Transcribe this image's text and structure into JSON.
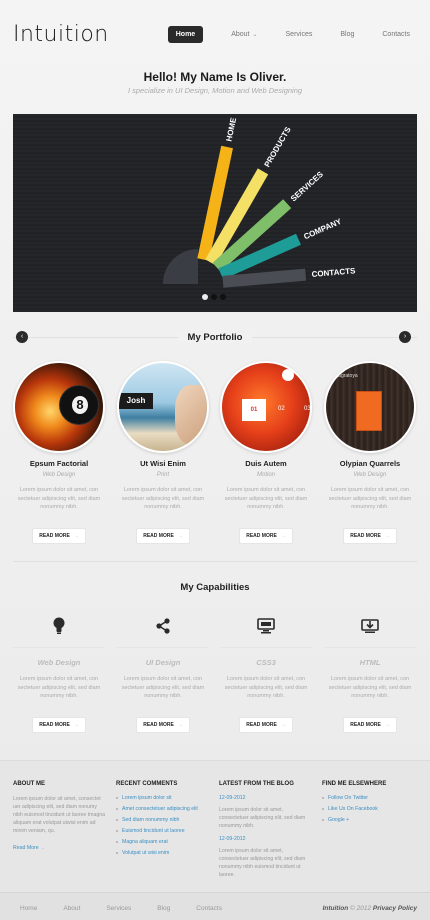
{
  "header": {
    "logo": "Intuition",
    "nav": [
      {
        "label": "Home"
      },
      {
        "label": "About"
      },
      {
        "label": "Services"
      },
      {
        "label": "Blog"
      },
      {
        "label": "Contacts"
      }
    ]
  },
  "hero": {
    "title": "Hello! My Name Is Oliver.",
    "subtitle": "I specialize in UI Design, Motion and Web Designing"
  },
  "slider": {
    "rays": [
      "HOME",
      "PRODUCTS",
      "SERVICES",
      "COMPANY",
      "CONTACTS"
    ],
    "ray_colors": [
      "#f6b317",
      "#f3e064",
      "#7fbf6a",
      "#1e9c97",
      "#4a4d54"
    ]
  },
  "portfolio": {
    "heading": "My Portfolio",
    "prev_icon": "chevron-left-icon",
    "next_icon": "chevron-right-icon",
    "items": [
      {
        "title": "Epsum Factorial",
        "category": "Web Design",
        "text": "Lorem ipsum dolor sit amet, con sectetuer adipiscing elit, sed diam nonummy nibh.",
        "button": "READ MORE"
      },
      {
        "title": "Ut Wisi Enim",
        "category": "Print",
        "text": "Lorem ipsum dolor sit amet, con sectetuer adipiscing elit, sed diam nonummy nibh.",
        "button": "READ MORE",
        "overlay": "Josh"
      },
      {
        "title": "Duis Autem",
        "category": "Motion",
        "text": "Lorem ipsum dolor sit amet, con sectetuer adipiscing elit, sed diam nonummy nibh.",
        "button": "READ MORE",
        "overlay_a": "01",
        "overlay_b": "02",
        "overlay_c": "03"
      },
      {
        "title": "Olypian Quarrels",
        "category": "Web Design",
        "text": "Lorem ipsum dolor sit amet, con sectetuer adipiscing elit, sed diam nonummy nibh.",
        "button": "READ MORE",
        "overlay": "magratoya"
      }
    ]
  },
  "capabilities": {
    "heading": "My Capabilities",
    "items": [
      {
        "title": "Web Design",
        "icon": "lightbulb-icon",
        "text": "Lorem ipsum dolor sit amet, con sectetuer adipiscing elit, sed diam nonummy nibh.",
        "button": "READ MORE"
      },
      {
        "title": "UI Design",
        "icon": "share-icon",
        "text": "Lorem ipsum dolor sit amet, con sectetuer adipiscing elit, sed diam nonummy nibh.",
        "button": "READ MORE"
      },
      {
        "title": "CSS3",
        "icon": "monitor-icon",
        "text": "Lorem ipsum dolor sit amet, con sectetuer adipiscing elit, sed diam nonummy nibh.",
        "button": "READ MORE"
      },
      {
        "title": "HTML",
        "icon": "download-screen-icon",
        "text": "Lorem ipsum dolor sit amet, con sectetuer adipiscing elit, sed diam nonummy nibh.",
        "button": "READ MORE"
      }
    ]
  },
  "footer": {
    "about": {
      "heading": "ABOUT ME",
      "text": "Lorem ipsum dolor sit amet, consectet uer adipiscing elit, sed diam nonumy nibh euismod tincidunt ut laoree tmagna aliquam erat volutpat utwisi enim ad minim veniam, qu.",
      "more": "Read More"
    },
    "comments": {
      "heading": "RECENT COMMENTS",
      "items": [
        "Lorem ipsum dolor sit",
        "Amet consectetuer adipiscing elit",
        "Sed diam nonummy nibh",
        "Euismod tincidunt ut laoree",
        "Magna aliquam erat",
        "Volutpat ut wisi enim"
      ]
    },
    "blog": {
      "heading": "LATEST FROM THE BLOG",
      "posts": [
        {
          "date": "12-09-2012",
          "text": "Lorem ipsum dolor sit amet, consectetuer adipiscing elit, sed diam nonummy nibh."
        },
        {
          "date": "12-09-2012",
          "text": "Lorem ipsum dolor sit amet, consectetuer adipiscing elit, sed diam nonummy nibh euismod tincidunt ut laoree."
        }
      ]
    },
    "social": {
      "heading": "FIND ME ELSEWHERE",
      "items": [
        "Follow On Twitter",
        "Like Us On Facebook",
        "Google +"
      ]
    }
  },
  "bottom": {
    "nav": [
      "Home",
      "About",
      "Services",
      "Blog",
      "Contacts"
    ],
    "brand": "Intuition",
    "copyright": "© 2012",
    "policy": "Privacy Policy"
  }
}
